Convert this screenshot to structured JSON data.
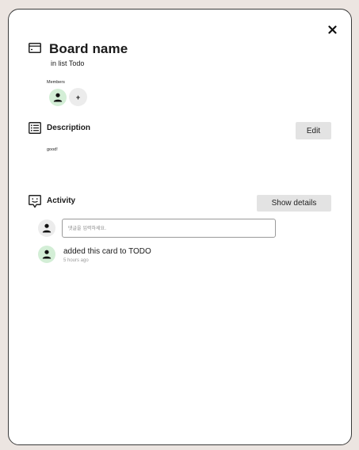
{
  "card": {
    "title": "Board name",
    "list_location": "in list Todo"
  },
  "members": {
    "label": "Members",
    "add_label": "+"
  },
  "description": {
    "heading": "Description",
    "edit_label": "Edit",
    "text": "good!"
  },
  "activity": {
    "heading": "Activity",
    "show_details_label": "Show details",
    "comment_placeholder": "댓글을 입력하세요.",
    "entries": [
      {
        "text": "added this card to TODO",
        "time": "5 hours ago"
      }
    ]
  },
  "colors": {
    "background": "#ece5e1",
    "avatar_active": "#d3eed6",
    "avatar_neutral": "#ececec",
    "button_bg": "#e3e3e3"
  },
  "icons": {
    "close": "close-icon",
    "card": "card-icon",
    "description": "list-icon",
    "activity": "comment-icon",
    "user": "user-icon"
  }
}
